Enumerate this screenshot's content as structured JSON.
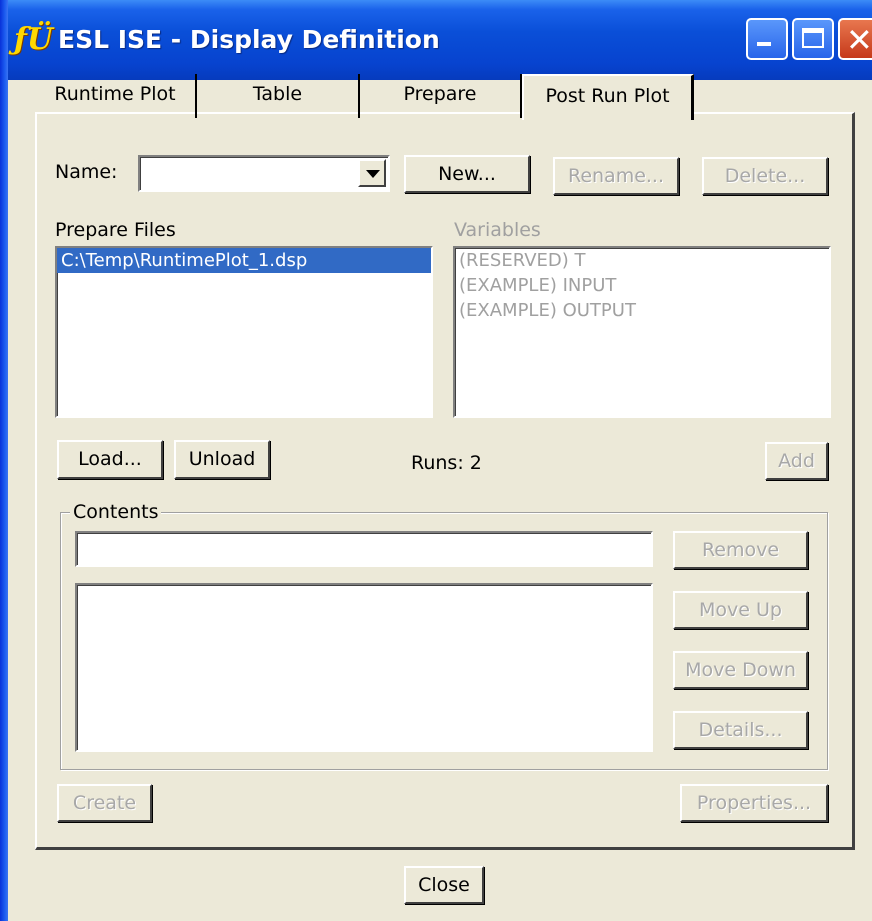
{
  "window": {
    "title": "ESL ISE - Display Definition",
    "icon": "esl-app-icon",
    "icon_glyph": "ƒÜ"
  },
  "tabs": [
    {
      "label": "Runtime Plot",
      "active": false
    },
    {
      "label": "Table",
      "active": false
    },
    {
      "label": "Prepare",
      "active": false
    },
    {
      "label": "Post Run Plot",
      "active": true
    }
  ],
  "name_row": {
    "label": "Name:",
    "value": "",
    "new_button": "New...",
    "rename_button": "Rename...",
    "delete_button": "Delete..."
  },
  "prepare_files": {
    "label": "Prepare Files",
    "items": [
      "C:\\Temp\\RuntimePlot_1.dsp"
    ]
  },
  "variables": {
    "label": "Variables",
    "items": [
      "(RESERVED) T",
      "(EXAMPLE) INPUT",
      "(EXAMPLE) OUTPUT"
    ]
  },
  "actions": {
    "load_button": "Load...",
    "unload_button": "Unload",
    "runs_text": "Runs: 2",
    "add_button": "Add"
  },
  "contents": {
    "label": "Contents",
    "field_value": "",
    "remove_button": "Remove",
    "move_up_button": "Move Up",
    "move_down_button": "Move Down",
    "details_button": "Details..."
  },
  "footer": {
    "create_button": "Create",
    "properties_button": "Properties...",
    "close_button": "Close"
  },
  "colors": {
    "title_bar": "#0a4fd8",
    "selection": "#316ac5",
    "face": "#ece9d8",
    "close_button": "#c6391a"
  }
}
